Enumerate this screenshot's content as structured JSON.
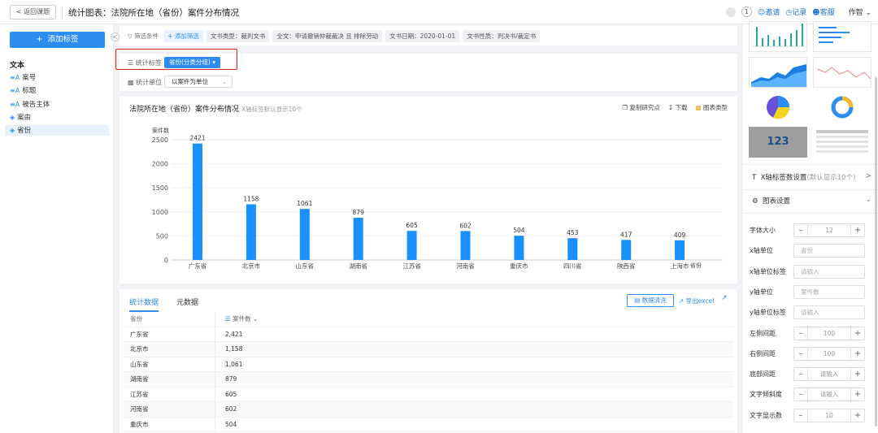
{
  "header": {
    "back": "返回课题",
    "title": "统计图表：法院所在地（省份）案件分布情况",
    "count": "1",
    "invite": "邀请",
    "record": "记录",
    "service": "客服",
    "user": "作智"
  },
  "sidebar": {
    "add": "添加标签",
    "section": "文本",
    "items": [
      "案号",
      "标题",
      "被告主体",
      "案由",
      "省份"
    ]
  },
  "filter": {
    "label": "筛选条件",
    "add": "添加筛选",
    "chips": [
      "文书类型：裁判文书",
      "全文：申请撤销仲裁裁决 且 排除劳动",
      "文书日期：2020-01-01",
      "文书性质：判决书/裁定书"
    ]
  },
  "config": {
    "tag_label": "统计标签",
    "tag_value": "省份(分类分组)",
    "unit_label": "统计单位",
    "unit_value": "以案件为单位"
  },
  "chart": {
    "title": "法院所在地（省份）案件分布情况",
    "subtitle": "X轴标签默认显示10个",
    "tools": [
      "复制研究点",
      "下载",
      "图表类型"
    ]
  },
  "chart_data": {
    "type": "bar",
    "categories": [
      "广东省",
      "北京市",
      "山东省",
      "湖南省",
      "江苏省",
      "河南省",
      "重庆市",
      "四川省",
      "陕西省",
      "上海市"
    ],
    "values": [
      2421,
      1158,
      1061,
      879,
      605,
      602,
      504,
      453,
      417,
      409
    ],
    "ylabel": "案件数",
    "xlabel": "省份",
    "ylim": [
      0,
      2500
    ],
    "yticks": [
      0,
      500,
      1000,
      1500,
      2000,
      2500
    ],
    "color": "#1890ff"
  },
  "table": {
    "tabs": [
      "统计数据",
      "元数据"
    ],
    "btn": "数据清洗",
    "export": "导出excel",
    "headers": [
      "省份",
      "案件数"
    ],
    "rows": [
      [
        "广东省",
        "2,421"
      ],
      [
        "北京市",
        "1,158"
      ],
      [
        "山东省",
        "1,061"
      ],
      [
        "湖南省",
        "879"
      ],
      [
        "江苏省",
        "605"
      ],
      [
        "河南省",
        "602"
      ],
      [
        "重庆市",
        "504"
      ]
    ]
  },
  "right": {
    "thumb_value": "123",
    "xaxis": "X轴标签数设置",
    "xaxis_sub": "(默认显示10个)",
    "chartset": "图表设置",
    "fields": [
      {
        "label": "字体大小",
        "kind": "step",
        "value": "12"
      },
      {
        "label": "x轴单位",
        "kind": "input",
        "value": "省份"
      },
      {
        "label": "x轴单位标签",
        "kind": "input",
        "value": "请输入"
      },
      {
        "label": "y轴单位",
        "kind": "input",
        "value": "案件数"
      },
      {
        "label": "y轴单位标签",
        "kind": "input",
        "value": "请输入"
      },
      {
        "label": "左侧间距",
        "kind": "step",
        "value": "100"
      },
      {
        "label": "右侧间距",
        "kind": "step",
        "value": "100"
      },
      {
        "label": "底部间距",
        "kind": "step",
        "value": "请输入"
      },
      {
        "label": "文字倾斜度",
        "kind": "step",
        "value": "请输入"
      },
      {
        "label": "文字显示数",
        "kind": "step",
        "value": "10"
      }
    ]
  }
}
